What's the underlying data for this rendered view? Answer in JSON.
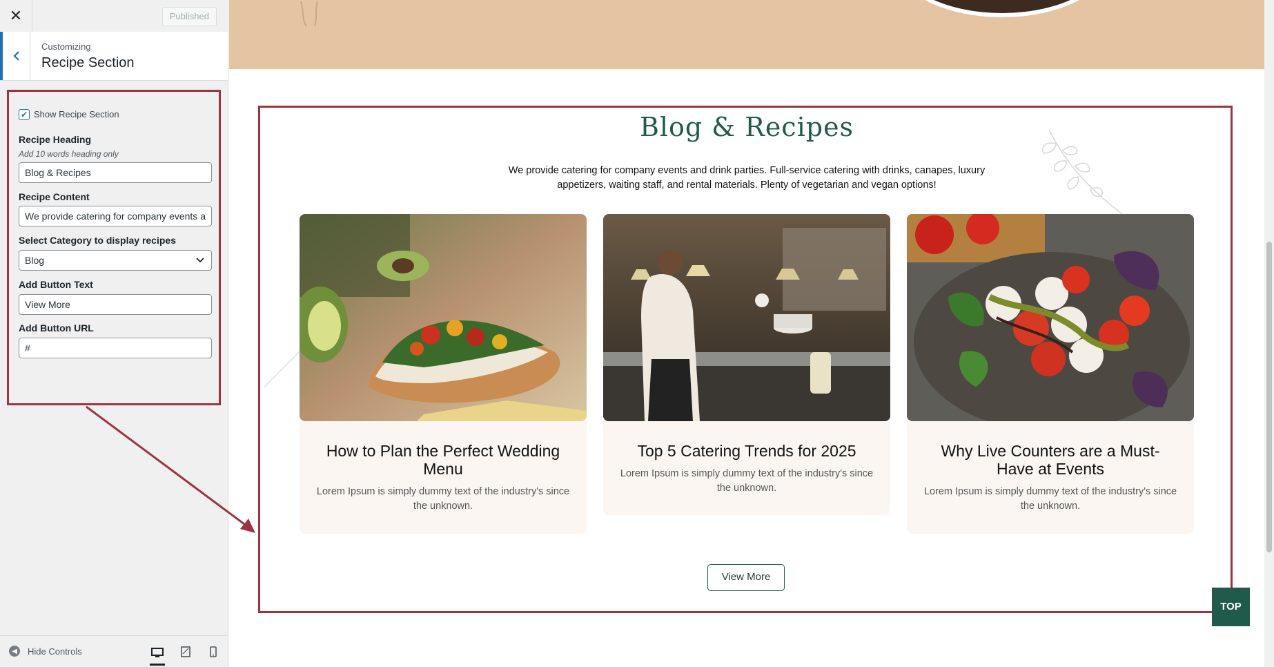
{
  "customizer": {
    "close_icon": "close-icon",
    "published_label": "Published",
    "customizing_label": "Customizing",
    "section_title": "Recipe Section",
    "show_section": {
      "label": "Show Recipe Section",
      "checked": true
    },
    "heading": {
      "label": "Recipe Heading",
      "description": "Add 10 words heading only",
      "value": "Blog & Recipes"
    },
    "content": {
      "label": "Recipe Content",
      "value": "We provide catering for company events a"
    },
    "category": {
      "label": "Select Category to display recipes",
      "value": "Blog"
    },
    "button_text": {
      "label": "Add Button Text",
      "value": "View More"
    },
    "button_url": {
      "label": "Add Button URL",
      "value": "#"
    },
    "hide_controls_label": "Hide Controls"
  },
  "preview": {
    "section_heading": "Blog & Recipes",
    "section_description": "We provide catering for company events and drink parties. Full-service catering with drinks, canapes, luxury appetizers, waiting staff, and rental materials. Plenty of vegetarian and vegan options!",
    "cards": [
      {
        "title": "How to Plan the Perfect Wedding Menu",
        "text": "Lorem Ipsum is simply dummy text of the industry's since the unknown.",
        "image": "sandwich-photo"
      },
      {
        "title": "Top 5 Catering Trends for 2025",
        "text": "Lorem Ipsum is simply dummy text of the industry's since the unknown.",
        "image": "kitchen-photo"
      },
      {
        "title": "Why Live Counters are a Must-Have at Events",
        "text": "Lorem Ipsum is simply dummy text of the industry's since the unknown.",
        "image": "caprese-photo"
      }
    ],
    "view_more_label": "View More",
    "top_label": "TOP"
  },
  "colors": {
    "accent_green": "#1f5a4a",
    "highlight_red": "#9b3440",
    "hero_tan": "#e4c4a1",
    "wp_blue": "#2271b1"
  }
}
